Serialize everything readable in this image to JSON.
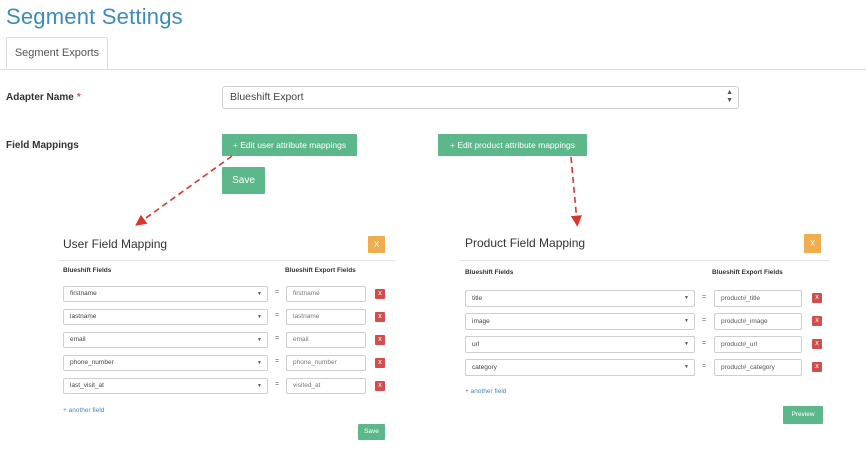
{
  "page": {
    "title": "Segment Settings"
  },
  "tabs": [
    {
      "label": "Segment Exports"
    }
  ],
  "form": {
    "adapter_label": "Adapter Name",
    "required_mark": "*",
    "adapter_value": "Blueshift Export",
    "field_mappings_label": "Field Mappings",
    "edit_user_label": "+ Edit user attribute mappings",
    "edit_product_label": "+ Edit product attribute mappings",
    "save_label": "Save"
  },
  "user_modal": {
    "title": "User Field Mapping",
    "close_label": "X",
    "col_left": "Blueshift Fields",
    "col_right": "Blueshift Export Fields",
    "rows": [
      {
        "field": "firstname",
        "eq": "=",
        "export": "firstname"
      },
      {
        "field": "lastname",
        "eq": "=",
        "export": "lastname"
      },
      {
        "field": "email",
        "eq": "=",
        "export": "email"
      },
      {
        "field": "phone_number",
        "eq": "=",
        "export": "phone_number"
      },
      {
        "field": "last_visit_at",
        "eq": "=",
        "export": "visited_at"
      }
    ],
    "delete_label": "x",
    "another_field": "+ another field",
    "save_label": "Save"
  },
  "product_modal": {
    "title": "Product Field Mapping",
    "close_label": "X",
    "col_left": "Blueshift Fields",
    "col_right": "Blueshift Export Fields",
    "rows": [
      {
        "field": "title",
        "eq": "=",
        "export": "product#_title"
      },
      {
        "field": "image",
        "eq": "=",
        "export": "product#_image"
      },
      {
        "field": "url",
        "eq": "=",
        "export": "product#_url"
      },
      {
        "field": "category",
        "eq": "=",
        "export": "product#_category"
      }
    ],
    "delete_label": "x",
    "another_field": "+ another field",
    "preview_label": "Preview"
  },
  "colors": {
    "accent": "#3b8cba",
    "green": "#5cb88a",
    "orange": "#efad4d",
    "red": "#d24d4b",
    "arrow": "#d9362f"
  }
}
